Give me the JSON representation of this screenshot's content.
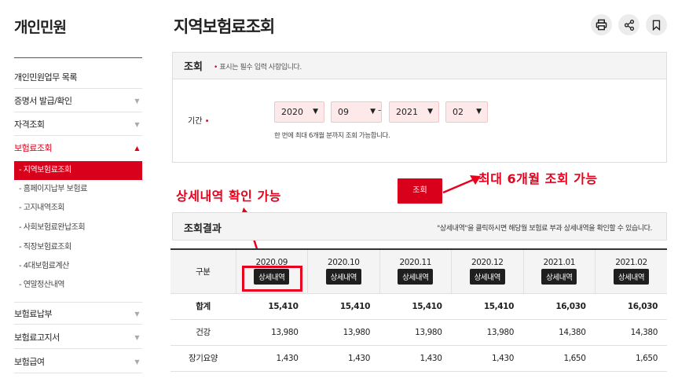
{
  "sidebar": {
    "title": "개인민원",
    "items": [
      {
        "label": "개인민원업무 목록"
      },
      {
        "label": "증명서 발급/확인",
        "chev": "▼"
      },
      {
        "label": "자격조회",
        "chev": "▼"
      },
      {
        "label": "보험료조회",
        "chev": "▲"
      }
    ],
    "subitems": [
      "- 지역보험료조회",
      "- 홈페이지납부 보험료",
      "- 고지내역조회",
      "- 사회보험료완납조회",
      "- 직장보험료조회",
      "- 4대보험료계산",
      "- 연말정산내역"
    ],
    "bottom_items": [
      {
        "label": "보험료납부",
        "chev": "▼"
      },
      {
        "label": "보험료고지서",
        "chev": "▼"
      },
      {
        "label": "보험급여",
        "chev": "▼"
      }
    ]
  },
  "page_title": "지역보험료조회",
  "search": {
    "heading": "조회",
    "note_dot": "•",
    "note": "표시는 필수 입력 사항입니다.",
    "period_label": "기간",
    "required_dot": "•",
    "from_year": "2020",
    "from_month": "09",
    "dash": "-",
    "to_year": "2021",
    "to_month": "02",
    "hint": "한 번에 최대 6개월 분까지 조회 가능합니다.",
    "submit": "조회"
  },
  "annotations": {
    "right": "최대 6개월 조회 가능",
    "left": "상세내역 확인 가능"
  },
  "results": {
    "heading": "조회결과",
    "hint": "\"상세내역\"을 클릭하시면 해당월 보험료 부과 상세내역을 확인할 수 있습니다.",
    "col_header": "구분",
    "detail_label": "상세내역",
    "periods": [
      "2020.09",
      "2020.10",
      "2020.11",
      "2020.12",
      "2021.01",
      "2021.02"
    ],
    "rows": [
      {
        "label": "합계",
        "values": [
          "15,410",
          "15,410",
          "15,410",
          "15,410",
          "16,030",
          "16,030"
        ]
      },
      {
        "label": "건강",
        "values": [
          "13,980",
          "13,980",
          "13,980",
          "13,980",
          "14,380",
          "14,380"
        ]
      },
      {
        "label": "장기요양",
        "values": [
          "1,430",
          "1,430",
          "1,430",
          "1,430",
          "1,650",
          "1,650"
        ]
      }
    ]
  },
  "colors": {
    "accent": "#d9001b",
    "annotation": "#e8001c"
  }
}
